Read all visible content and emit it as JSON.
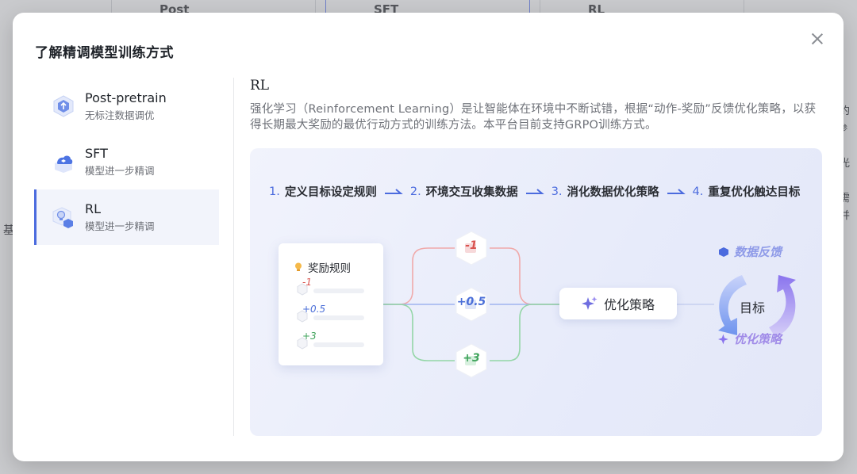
{
  "background": {
    "tabs": [
      "Post",
      "SFT",
      "RL"
    ],
    "left_text": "基",
    "right_text": [
      "约",
      "参",
      "光",
      "需",
      "并"
    ]
  },
  "modal": {
    "title": "了解精调模型训练方式",
    "close_label": "×"
  },
  "sidebar": {
    "items": [
      {
        "title": "Post-pretrain",
        "subtitle": "无标注数据调优",
        "icon": "hexagon-upload-icon",
        "active": false
      },
      {
        "title": "SFT",
        "subtitle": "模型进一步精调",
        "icon": "cloud-cube-icon",
        "active": false
      },
      {
        "title": "RL",
        "subtitle": "模型进一步精调",
        "icon": "bulb-cube-icon",
        "active": true
      }
    ]
  },
  "content": {
    "title": "RL",
    "description": "强化学习（Reinforcement Learning）是让智能体在环境中不断试错，根据“动作-奖励”反馈优化策略，以获得长期最大奖励的最优行动方式的训练方法。本平台目前支持GRPO训练方式。"
  },
  "diagram": {
    "steps": [
      {
        "num": "1.",
        "label": "定义目标设定规则"
      },
      {
        "num": "2.",
        "label": "环境交互收集数据"
      },
      {
        "num": "3.",
        "label": "消化数据优化策略"
      },
      {
        "num": "4.",
        "label": "重复优化触达目标"
      }
    ],
    "reward_card": {
      "title": "奖励规则",
      "rows": [
        "-1",
        "+0.5",
        "+3"
      ]
    },
    "nodes": [
      {
        "value": "-1",
        "color": "#d9534f"
      },
      {
        "value": "+0.5",
        "color": "#4a6ed8"
      },
      {
        "value": "+3",
        "color": "#3fa35b"
      }
    ],
    "optimize_label": "优化策略",
    "cycle": {
      "top_label": "数据反馈",
      "center_label": "目标",
      "bottom_label": "优化策略"
    },
    "colors": {
      "accent": "#4b6bde",
      "negative": "#d9534f",
      "neutral": "#4a6ed8",
      "positive": "#3fa35b"
    }
  }
}
